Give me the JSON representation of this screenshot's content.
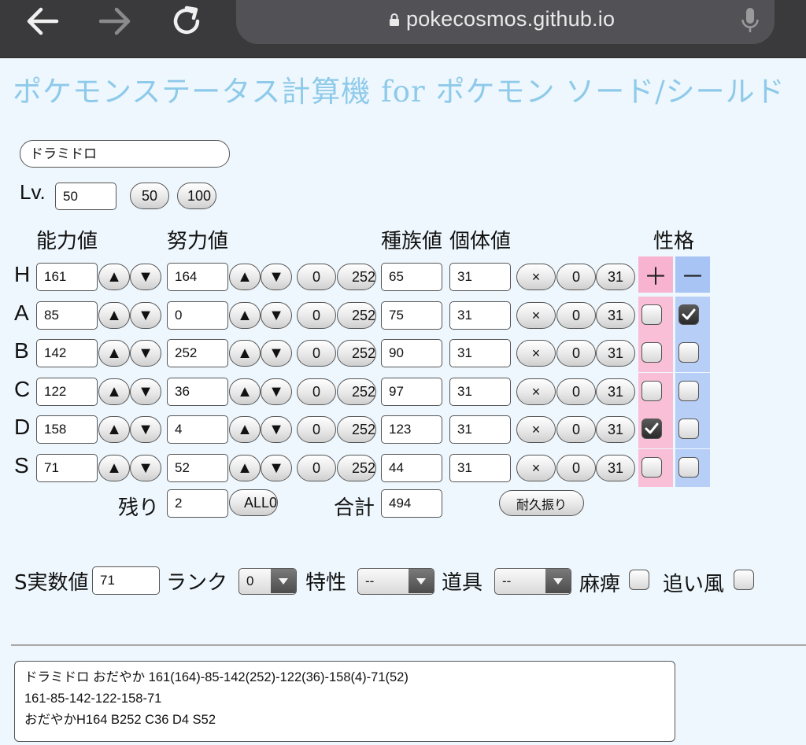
{
  "browser": {
    "url": "pokecosmos.github.io",
    "icons": {
      "back": "back-arrow-icon",
      "forward": "forward-arrow-icon",
      "reload": "reload-icon",
      "lock": "lock-icon",
      "mic": "microphone-icon"
    }
  },
  "page": {
    "title": "ポケモンステータス計算機 for ポケモン ソード/シールド",
    "pokemon_name": "ドラミドロ",
    "level_label": "Lv.",
    "level_value": "50",
    "level_buttons": [
      "50",
      "100"
    ]
  },
  "headers": {
    "stat": "能力値",
    "ev": "努力値",
    "base": "種族値",
    "iv": "個体値",
    "nature": "性格",
    "nature_plus": "＋",
    "nature_minus": "－"
  },
  "button_labels": {
    "up": "▲",
    "down": "▼",
    "ev_min": "0",
    "ev_max": "252",
    "iv_clear": "×",
    "iv_min": "0",
    "iv_max": "31"
  },
  "stats": [
    {
      "label": "H",
      "stat": "161",
      "ev": "164",
      "base": "65",
      "iv": "31"
    },
    {
      "label": "A",
      "stat": "85",
      "ev": "0",
      "base": "75",
      "iv": "31"
    },
    {
      "label": "B",
      "stat": "142",
      "ev": "252",
      "base": "90",
      "iv": "31"
    },
    {
      "label": "C",
      "stat": "122",
      "ev": "36",
      "base": "97",
      "iv": "31"
    },
    {
      "label": "D",
      "stat": "158",
      "ev": "4",
      "base": "123",
      "iv": "31"
    },
    {
      "label": "S",
      "stat": "71",
      "ev": "52",
      "base": "44",
      "iv": "31"
    }
  ],
  "nature": {
    "plus_checked": [
      false,
      false,
      false,
      false,
      true,
      false
    ],
    "minus_checked": [
      false,
      true,
      false,
      false,
      false,
      false
    ]
  },
  "summary_row": {
    "remaining_label": "残り",
    "remaining_value": "2",
    "all0_label": "ALL0",
    "total_label": "合計",
    "total_value": "494",
    "bulk_button": "耐久振り"
  },
  "speed_row": {
    "speed_label": "S実数値",
    "speed_value": "71",
    "rank_label": "ランク",
    "rank_value": "0",
    "ability_label": "特性",
    "ability_value": "--",
    "item_label": "道具",
    "item_value": "--",
    "paralysis_label": "麻痺",
    "tailwind_label": "追い風"
  },
  "output_lines": [
    "ドラミドロ おだやか 161(164)-85-142(252)-122(36)-158(4)-71(52)",
    "161-85-142-122-158-71",
    "おだやかH164 B252 C36 D4 S52"
  ]
}
